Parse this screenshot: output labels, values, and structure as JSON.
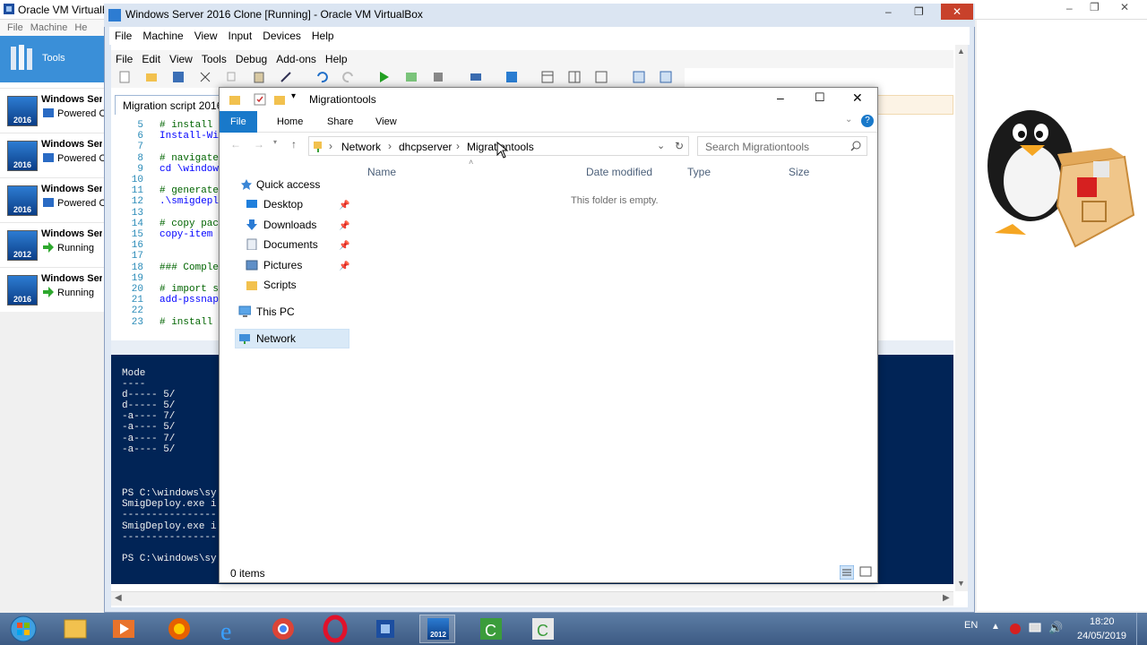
{
  "outer": {
    "title": "Oracle VM VirtualBox",
    "menu": [
      "File",
      "Machine",
      "He"
    ],
    "tools_label": "Tools",
    "vms": [
      {
        "name": "Windows Ser",
        "state": "Powered Of",
        "badge": "2016",
        "state_icon": "powered-off-icon"
      },
      {
        "name": "Windows Ser",
        "state": "Powered Of",
        "badge": "2016",
        "state_icon": "powered-off-icon"
      },
      {
        "name": "Windows Ser",
        "state": "Powered Of",
        "badge": "2016",
        "state_icon": "powered-off-icon"
      },
      {
        "name": "Windows Ser",
        "state": "Running",
        "badge": "2012",
        "state_icon": "running-arrow-icon"
      },
      {
        "name": "Windows Ser",
        "state": "Running",
        "badge": "2016",
        "state_icon": "running-arrow-icon"
      }
    ]
  },
  "vm_window": {
    "title": "Windows Server 2016 Clone [Running] - Oracle VM VirtualBox",
    "menu": [
      "File",
      "Machine",
      "View",
      "Input",
      "Devices",
      "Help"
    ]
  },
  "ise": {
    "menu": [
      "File",
      "Edit",
      "View",
      "Tools",
      "Debug",
      "Add-ons",
      "Help"
    ],
    "tab_label": "Migration script 2016",
    "lines": [
      {
        "n": "5",
        "text": "# install",
        "kind": "cm"
      },
      {
        "n": "6",
        "text": "Install-Wi",
        "kind": "cmd"
      },
      {
        "n": "7",
        "text": "",
        "kind": ""
      },
      {
        "n": "8",
        "text": "# navigate",
        "kind": "cm"
      },
      {
        "n": "9",
        "text": "cd \\window",
        "kind": "cmd"
      },
      {
        "n": "10",
        "text": "",
        "kind": ""
      },
      {
        "n": "11",
        "text": "# generate",
        "kind": "cm"
      },
      {
        "n": "12",
        "text": ".\\smigdepl",
        "kind": "cmd"
      },
      {
        "n": "13",
        "text": "",
        "kind": ""
      },
      {
        "n": "14",
        "text": "# copy pac",
        "kind": "cm"
      },
      {
        "n": "15",
        "text": "copy-item",
        "kind": "cmd"
      },
      {
        "n": "16",
        "text": "",
        "kind": ""
      },
      {
        "n": "17",
        "text": "",
        "kind": ""
      },
      {
        "n": "18",
        "text": "### Comple",
        "kind": "cm"
      },
      {
        "n": "19",
        "text": "",
        "kind": ""
      },
      {
        "n": "20",
        "text": "# import s",
        "kind": "cm"
      },
      {
        "n": "21",
        "text": "add-pssnap",
        "kind": "cmd"
      },
      {
        "n": "22",
        "text": "",
        "kind": ""
      },
      {
        "n": "23",
        "text": "# install",
        "kind": "cm"
      }
    ],
    "console_lines": [
      "Mode",
      "----",
      "d-----        5/",
      "d-----        5/",
      "-a----        7/",
      "-a----        5/",
      "-a----        7/",
      "-a----        5/",
      "PS C:\\windows\\sy",
      "SmigDeploy.exe i",
      "----------------",
      "SmigDeploy.exe i",
      "----------------",
      "PS C:\\windows\\sy"
    ]
  },
  "explorer": {
    "title": "Migrationtools",
    "ribbon_tabs": [
      "File",
      "Home",
      "Share",
      "View"
    ],
    "breadcrumb": [
      "Network",
      "dhcpserver",
      "Migrationtools"
    ],
    "search_placeholder": "Search Migrationtools",
    "nav": {
      "quick_access": "Quick access",
      "items": [
        "Desktop",
        "Downloads",
        "Documents",
        "Pictures",
        "Scripts"
      ],
      "this_pc": "This PC",
      "network": "Network"
    },
    "columns": [
      "Name",
      "Date modified",
      "Type",
      "Size"
    ],
    "empty_text": "This folder is empty.",
    "status": "0 items"
  },
  "taskbar": {
    "lang": "EN",
    "time": "18:20",
    "date": "24/05/2019",
    "vm_badge": "2012"
  },
  "colors": {
    "accent": "#1979ca",
    "console_bg": "#012456",
    "tools_bg": "#3a8fd8"
  }
}
